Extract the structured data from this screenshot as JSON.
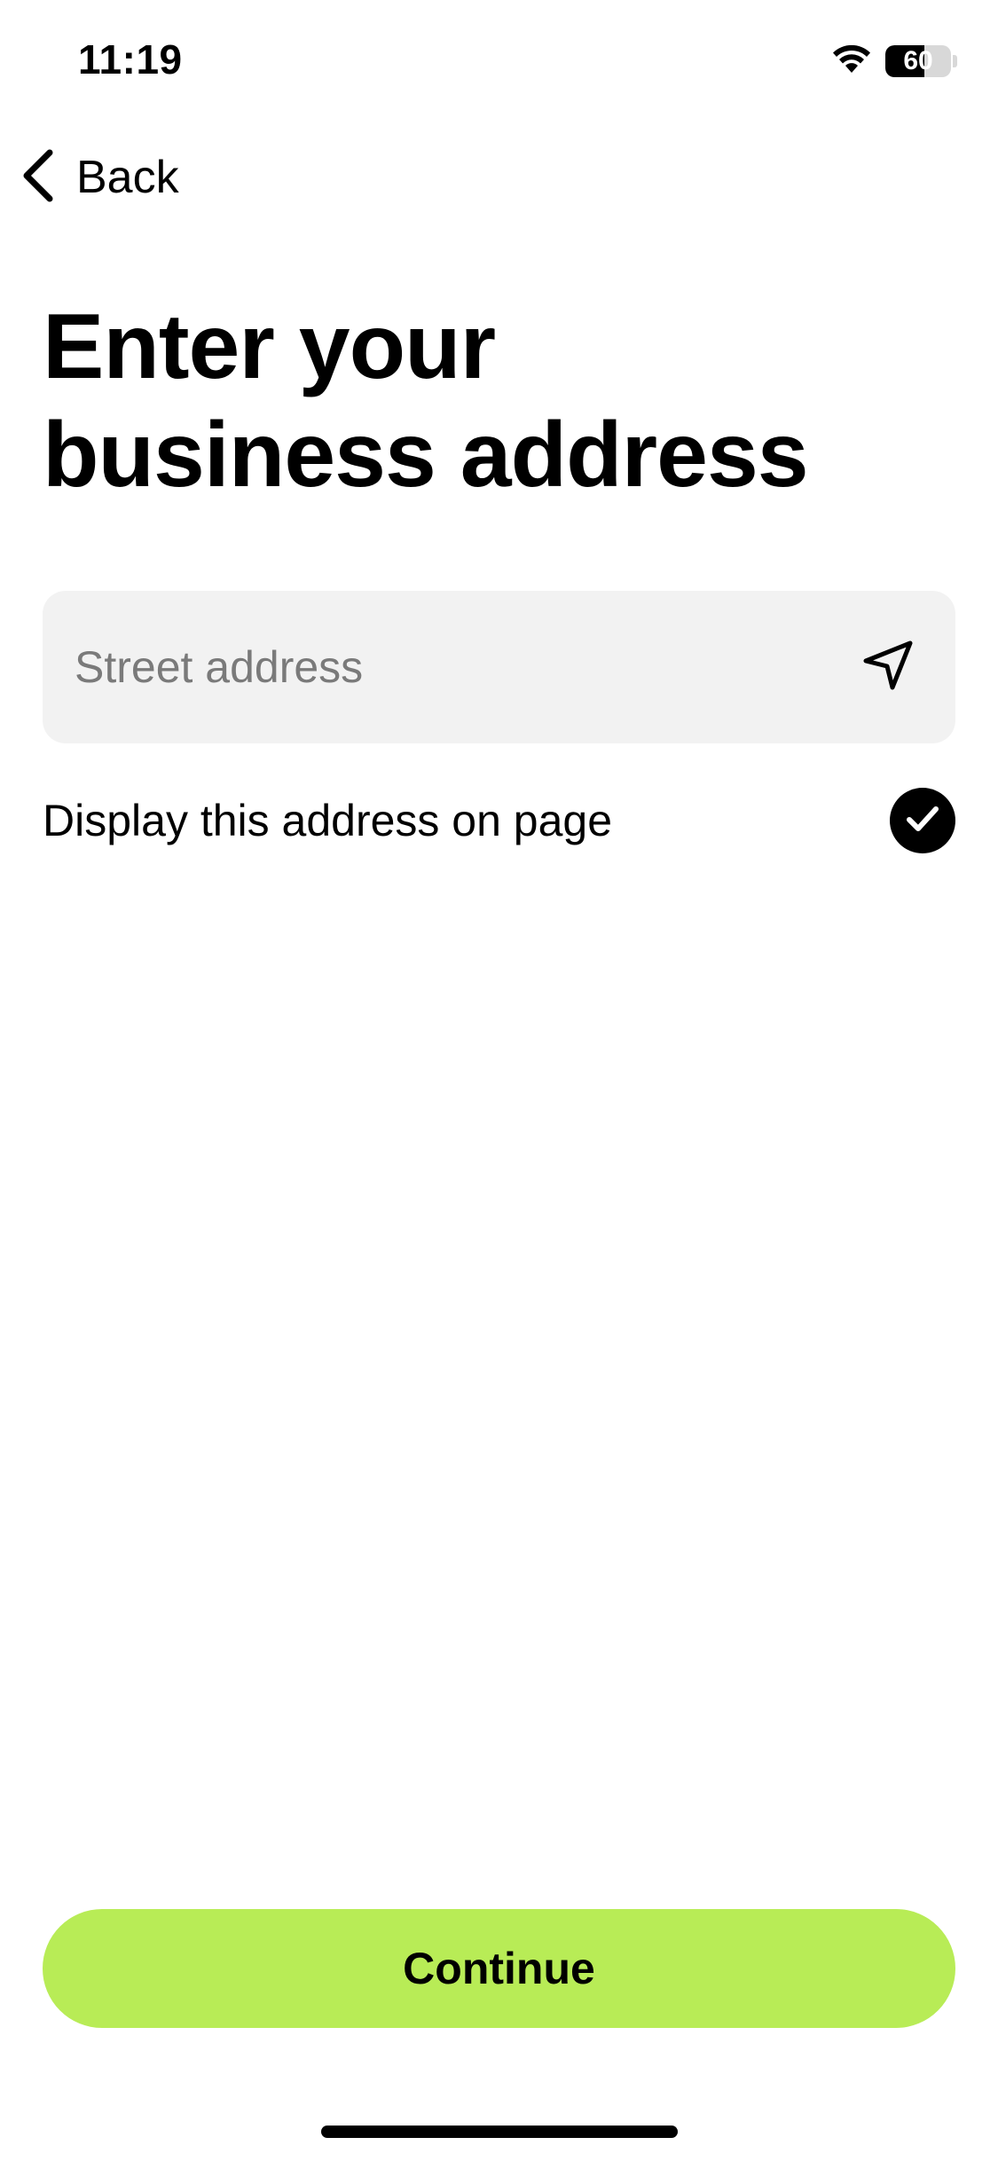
{
  "status_bar": {
    "time": "11:19",
    "battery_level": "60",
    "battery_fraction": 0.6,
    "icons": [
      "wifi-icon",
      "battery-icon"
    ]
  },
  "nav": {
    "back_label": "Back",
    "back_icon": "chevron-left-icon"
  },
  "page": {
    "title_line1": "Enter your",
    "title_line2": "business address"
  },
  "address": {
    "placeholder": "Street address",
    "value": "",
    "location_icon": "navigation-arrow-icon"
  },
  "display_option": {
    "label": "Display this address on page",
    "checked": true,
    "icon": "checkmark-icon"
  },
  "footer": {
    "continue_label": "Continue"
  },
  "colors": {
    "accent": "#B8EC56",
    "input_bg": "#F2F2F2",
    "placeholder": "#7A7A7A",
    "text": "#000000",
    "background": "#FFFFFF"
  }
}
